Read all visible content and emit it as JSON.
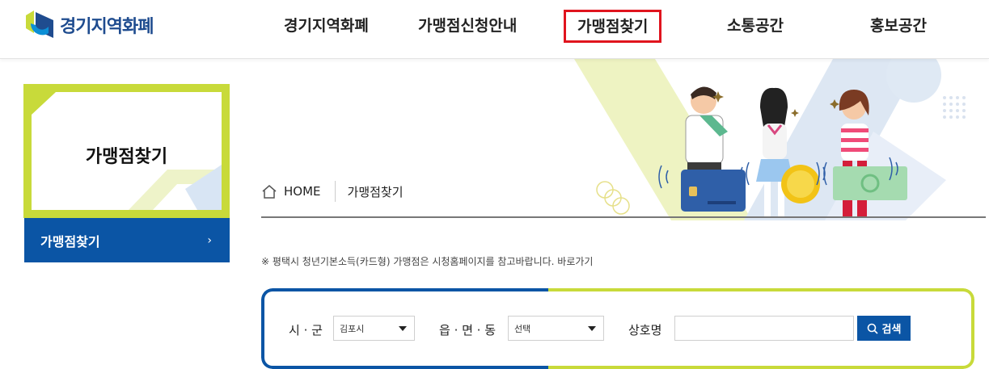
{
  "header": {
    "logo_text": "경기지역화폐",
    "nav": [
      {
        "label": "경기지역화폐",
        "active": false
      },
      {
        "label": "가맹점신청안내",
        "active": false
      },
      {
        "label": "가맹점찾기",
        "active": true
      },
      {
        "label": "소통공간",
        "active": false
      },
      {
        "label": "홍보공간",
        "active": false
      }
    ]
  },
  "side": {
    "title": "가맹점찾기",
    "menu_item": "가맹점찾기",
    "menu_arrow": "›"
  },
  "breadcrumb": {
    "home": "HOME",
    "current": "가맹점찾기"
  },
  "notice": {
    "text": "※ 평택시 청년기본소득(카드형) 가맹점은 시청홈페이지를 참고바랍니다.",
    "link": "바로가기"
  },
  "search": {
    "city_label": "시 · 군",
    "city_value": "김포시",
    "dong_label": "읍 · 면 · 동",
    "dong_value": "선택",
    "name_label": "상호명",
    "name_value": "",
    "button_label": "검색"
  },
  "colors": {
    "brand_blue": "#0b55a5",
    "brand_green": "#c8da3a",
    "highlight_red": "#e0141e"
  }
}
